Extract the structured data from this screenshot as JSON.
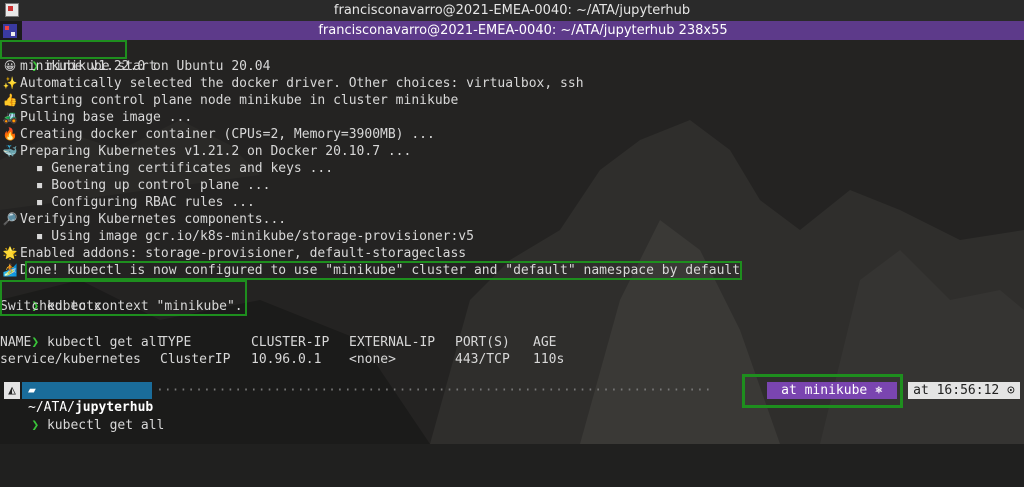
{
  "window": {
    "title": "francisconavarro@2021-EMEA-0040: ~/ATA/jupyterhub",
    "tab_title": "francisconavarro@2021-EMEA-0040: ~/ATA/jupyterhub 238x55"
  },
  "terminal": {
    "cmd1": "minikube start",
    "output": [
      {
        "icon": "smile-icon",
        "glyph": "😀",
        "text": "minikube v1.22.0 on Ubuntu 20.04"
      },
      {
        "icon": "sparkles-icon",
        "glyph": "✨",
        "text": "Automatically selected the docker driver. Other choices: virtualbox, ssh"
      },
      {
        "icon": "thumbs-up-icon",
        "glyph": "👍",
        "text": "Starting control plane node minikube in cluster minikube"
      },
      {
        "icon": "tractor-icon",
        "glyph": "🚜",
        "text": "Pulling base image ..."
      },
      {
        "icon": "fire-icon",
        "glyph": "🔥",
        "text": "Creating docker container (CPUs=2, Memory=3900MB) ..."
      },
      {
        "icon": "whale-icon",
        "glyph": "🐳",
        "text": "Preparing Kubernetes v1.21.2 on Docker 20.10.7 ..."
      },
      {
        "icon": "",
        "glyph": "",
        "text": "  ▪ Generating certificates and keys ..."
      },
      {
        "icon": "",
        "glyph": "",
        "text": "  ▪ Booting up control plane ..."
      },
      {
        "icon": "",
        "glyph": "",
        "text": "  ▪ Configuring RBAC rules ..."
      },
      {
        "icon": "magnifier-icon",
        "glyph": "🔎",
        "text": "Verifying Kubernetes components..."
      },
      {
        "icon": "",
        "glyph": "",
        "text": "  ▪ Using image gcr.io/k8s-minikube/storage-provisioner:v5"
      },
      {
        "icon": "star-icon",
        "glyph": "🌟",
        "text": "Enabled addons: storage-provisioner, default-storageclass"
      },
      {
        "icon": "surfer-icon",
        "glyph": "🏄",
        "text": "Done! kubectl is now configured to use \"minikube\" cluster and \"default\" namespace by default"
      }
    ],
    "cmd2": "kubectx",
    "cmd2_output": "Switched to context \"minikube\".",
    "cmd3": "kubectl get all",
    "table": {
      "headers": [
        "NAME",
        "TYPE",
        "CLUSTER-IP",
        "EXTERNAL-IP",
        "PORT(S)",
        "AGE"
      ],
      "rows": [
        [
          "service/kubernetes",
          "ClusterIP",
          "10.96.0.1",
          "<none>",
          "443/TCP",
          "110s"
        ]
      ]
    },
    "prompt": {
      "path_prefix": "~/ATA/",
      "path_dir": "jupyterhub",
      "context": "at minikube ⎈",
      "time": "at 16:56:12 ⊙"
    },
    "cmd4": "kubectl get all"
  },
  "colors": {
    "prompt_arrow": "#39c539",
    "highlight_box": "#1e8e1e",
    "tab_purple": "#5d3a8a"
  }
}
